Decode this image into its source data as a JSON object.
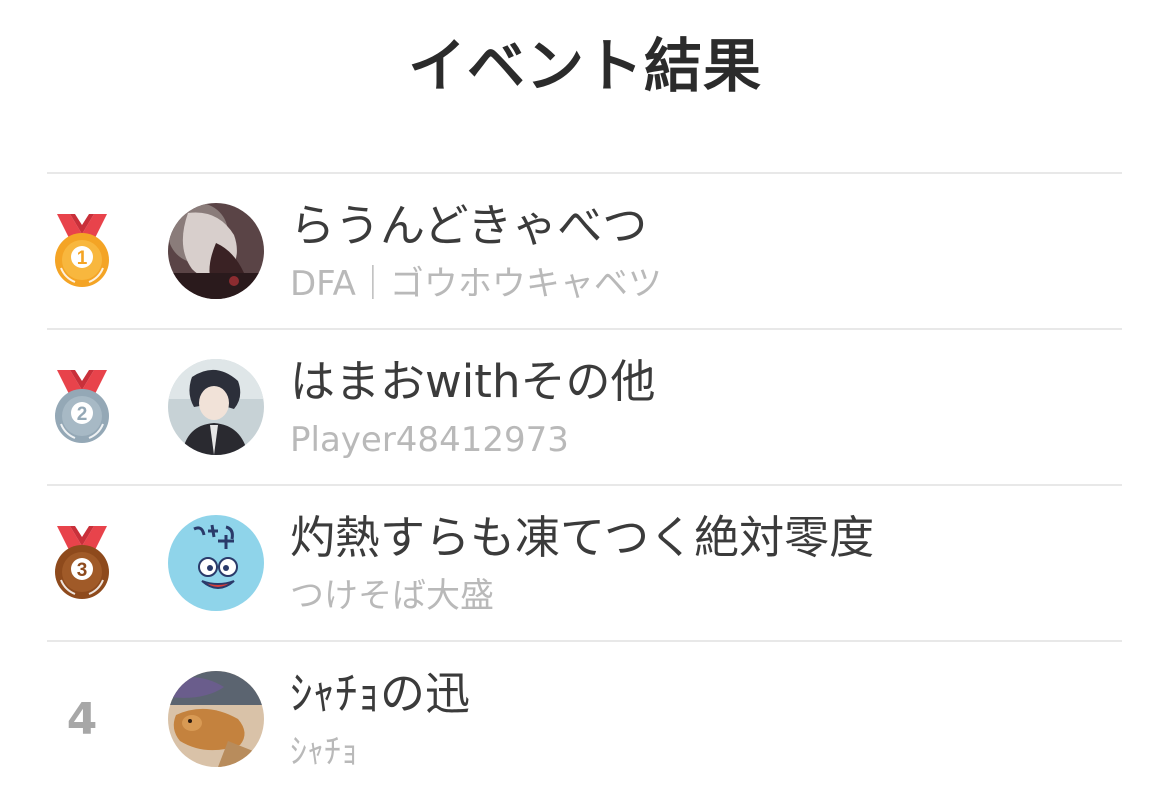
{
  "header": {
    "title": "イベント結果"
  },
  "results": [
    {
      "rank": "1",
      "rank_display": "medal",
      "medal_icon": "gold-medal-icon",
      "medal_color": "#f4a425",
      "player_name": "らうんどきゃべつ",
      "team_name": "DFA｜ゴウホウキャベツ"
    },
    {
      "rank": "2",
      "rank_display": "medal",
      "medal_icon": "silver-medal-icon",
      "medal_color": "#94a8b6",
      "player_name": "はまおwithその他",
      "team_name": "Player48412973"
    },
    {
      "rank": "3",
      "rank_display": "medal",
      "medal_icon": "bronze-medal-icon",
      "medal_color": "#8e4a1c",
      "player_name": "灼熱すらも凍てつく絶対零度",
      "team_name": "つけそば大盛"
    },
    {
      "rank": "4",
      "rank_display": "number",
      "player_name": "ｼｬﾁｮの迅",
      "team_name": "ｼｬﾁｮ"
    }
  ],
  "colors": {
    "medal_ribbon": "#e8434b",
    "divider": "#e8e8e8",
    "name_text": "#3b3b3b",
    "team_text": "#b9b9b9"
  }
}
